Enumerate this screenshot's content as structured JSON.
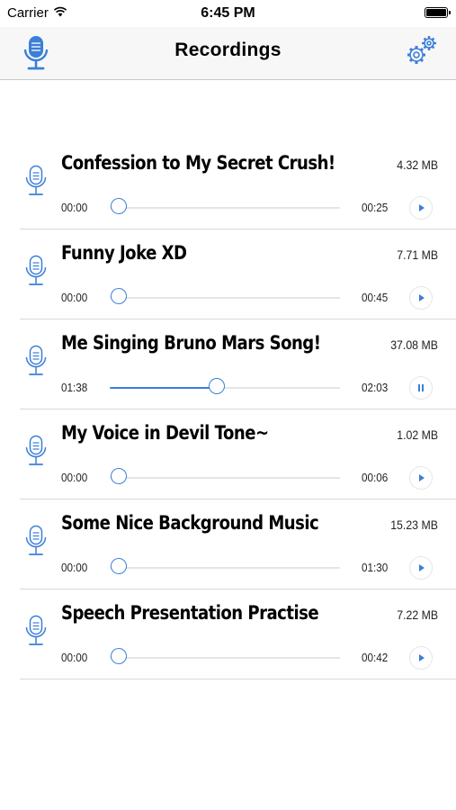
{
  "status_bar": {
    "carrier": "Carrier",
    "time": "6:45 PM"
  },
  "nav": {
    "title": "Recordings",
    "left_icon": "microphone-icon",
    "right_icon": "gear-icon"
  },
  "accent_color": "#3a7fd9",
  "recordings": [
    {
      "title": "Confession to My Secret Crush!",
      "size": "4.32 MB",
      "current_time": "00:00",
      "total_time": "00:25",
      "progress": 0.0,
      "state": "play"
    },
    {
      "title": "Funny Joke XD",
      "size": "7.71 MB",
      "current_time": "00:00",
      "total_time": "00:45",
      "progress": 0.0,
      "state": "play"
    },
    {
      "title": "Me Singing Bruno Mars Song!",
      "size": "37.08 MB",
      "current_time": "01:38",
      "total_time": "02:03",
      "progress": 0.46,
      "state": "pause"
    },
    {
      "title": "My Voice in Devil Tone~",
      "size": "1.02 MB",
      "current_time": "00:00",
      "total_time": "00:06",
      "progress": 0.0,
      "state": "play"
    },
    {
      "title": "Some Nice Background Music",
      "size": "15.23 MB",
      "current_time": "00:00",
      "total_time": "01:30",
      "progress": 0.0,
      "state": "play"
    },
    {
      "title": "Speech Presentation Practise",
      "size": "7.22 MB",
      "current_time": "00:00",
      "total_time": "00:42",
      "progress": 0.0,
      "state": "play"
    }
  ]
}
